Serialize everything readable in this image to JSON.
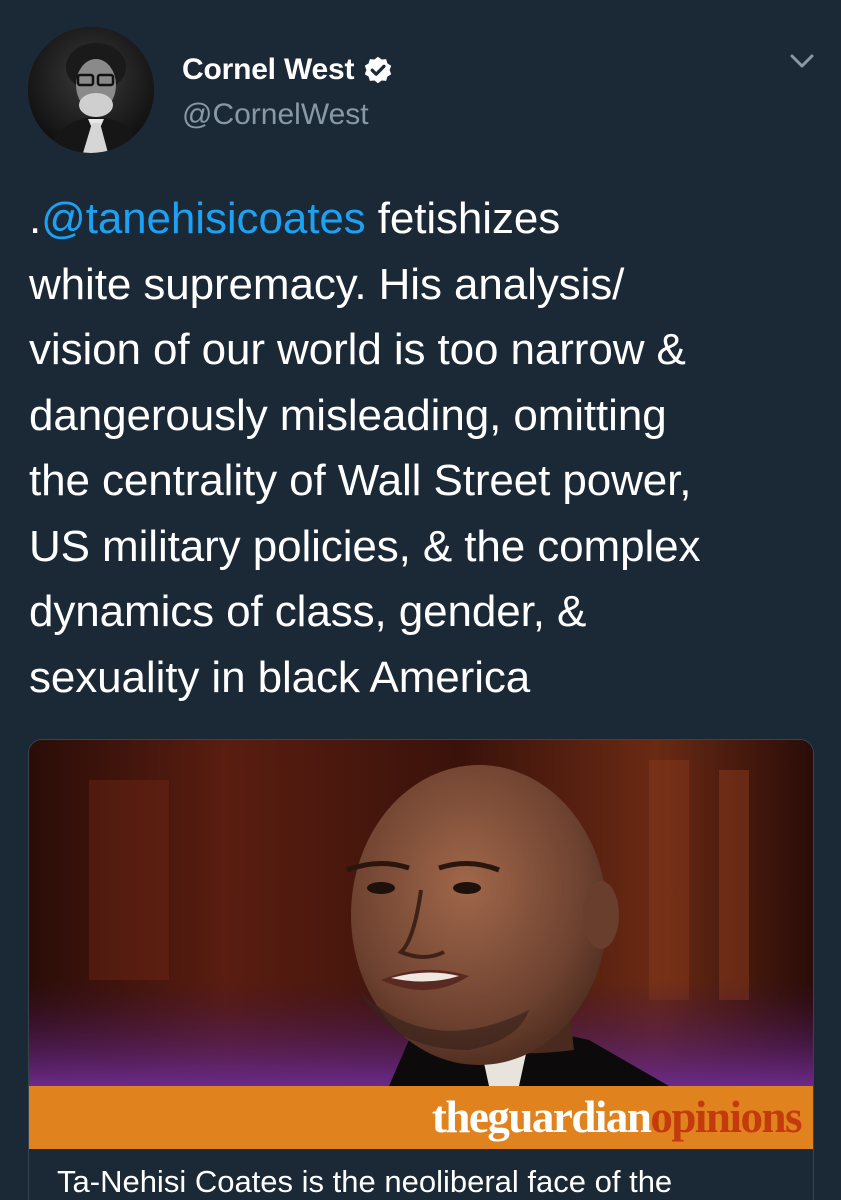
{
  "tweet": {
    "author": {
      "display_name": "Cornel West",
      "handle": "@CornelWest",
      "verified": true,
      "avatar_icon": "profile-photo"
    },
    "text_lead": ".",
    "mention": "@tanehisicoates",
    "text_body": " fetishizes\nwhite supremacy. His analysis/\nvision of our world is too narrow &\ndangerously misleading, omitting\nthe centrality of Wall Street power,\nUS military policies, & the complex\ndynamics of class, gender, &\nsexuality in black America",
    "mention_color": "#1da1f2"
  },
  "card": {
    "brand_part1": "theguardian",
    "brand_part2": "opinions",
    "brand_bar_color": "#e0831f",
    "title": "Ta-Nehisi Coates is the neoliberal face of the"
  },
  "icons": {
    "verified": "verified-badge-icon",
    "caret": "chevron-down-icon"
  },
  "colors": {
    "background": "#1b2836",
    "secondary_text": "#8899a6"
  }
}
